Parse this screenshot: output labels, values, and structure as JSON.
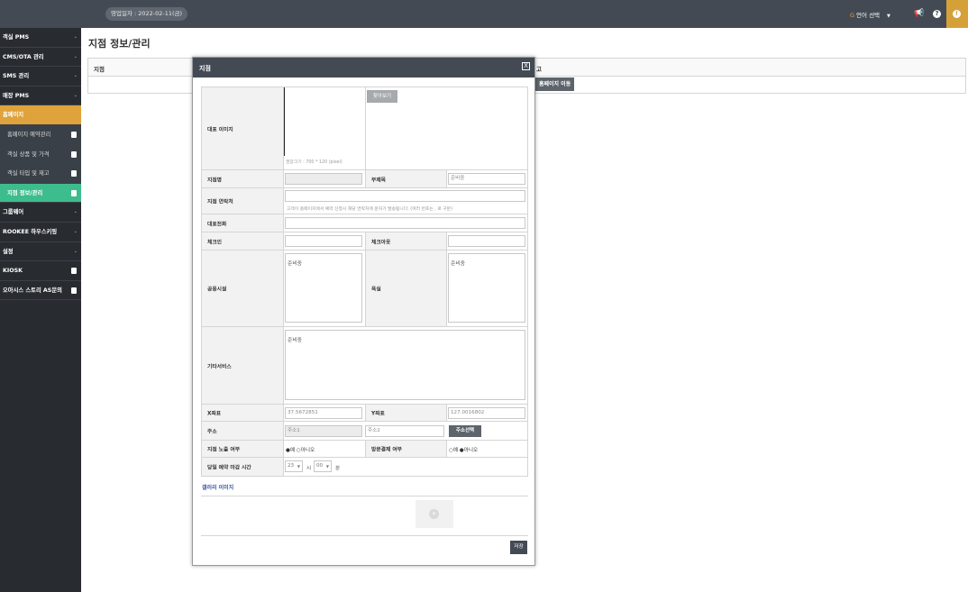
{
  "topbar": {
    "business_date": "영업일자 : 2022-02-11(금)",
    "language": "언어 선택",
    "icons": [
      "megaphone-icon",
      "question-icon",
      "warning-icon"
    ]
  },
  "sidebar": {
    "items": [
      {
        "label": "객실 PMS",
        "type": "group"
      },
      {
        "label": "CMS/OTA 관리",
        "type": "group"
      },
      {
        "label": "SMS 관리",
        "type": "group"
      },
      {
        "label": "매장 PMS",
        "type": "group"
      },
      {
        "label": "홈페이지",
        "type": "group-active"
      },
      {
        "label": "홈페이지 예약관리",
        "type": "sub"
      },
      {
        "label": "객실 상품 및 가격",
        "type": "sub"
      },
      {
        "label": "객실 타입 및 재고",
        "type": "sub"
      },
      {
        "label": "지점 정보/관리",
        "type": "sub-active"
      },
      {
        "label": "그룹웨어",
        "type": "group"
      },
      {
        "label": "ROOKEE 하우스키핑",
        "type": "group"
      },
      {
        "label": "설정",
        "type": "group"
      },
      {
        "label": "KIOSK",
        "type": "link"
      },
      {
        "label": "오아시스 스토리 AS문의",
        "type": "link"
      }
    ]
  },
  "main": {
    "title": "지점 정보/관리",
    "table": {
      "col1": "지점",
      "col2": "고",
      "move_button": "홈페이지 이동"
    }
  },
  "modal": {
    "title": "지점",
    "close": "X",
    "form": {
      "main_image_label": "대표 이미지",
      "main_image_button": "찾아보기",
      "main_image_hint": "권장크기 : 700 * 120 (pixel)",
      "branch_name_label": "지점명",
      "branch_name_value": "",
      "subtitle_label": "부제목",
      "subtitle_value": "준비중",
      "contact_label": "지점 연락처",
      "contact_value": "",
      "contact_hint": "고객이 홈페이지에서 예약 신청시 해당 연락처에 문자가 발송됩니다. (여러 번호는 , 로 구분)",
      "phone_label": "대표전화",
      "phone_value": "",
      "checkin_label": "체크인",
      "checkin_value": "",
      "checkout_label": "체크아웃",
      "checkout_value": "",
      "facilities_label": "공용시설",
      "facilities_value": "준비중",
      "bath_label": "욕실",
      "bath_value": "준비중",
      "other_label": "기타서비스",
      "other_value": "준비중",
      "x_label": "X좌표",
      "x_value": "37.5672851",
      "y_label": "Y좌표",
      "y_value": "127.0016802",
      "address_label": "주소",
      "address1_placeholder": "주소1",
      "address2_placeholder": "주소2",
      "address_search_button": "주소선택",
      "exposure_label": "지점 노출 여부",
      "exposure_value": "●예 ○아니오",
      "onsite_label": "방문결제 여부",
      "onsite_value": "○예 ●아니오",
      "deadline_label": "당일 예약 마감 시간",
      "deadline_hour": "23",
      "deadline_hour_unit": "시",
      "deadline_minute": "00",
      "deadline_minute_unit": "분"
    },
    "gallery_title": "갤러리 이미지",
    "save_button": "저장"
  }
}
